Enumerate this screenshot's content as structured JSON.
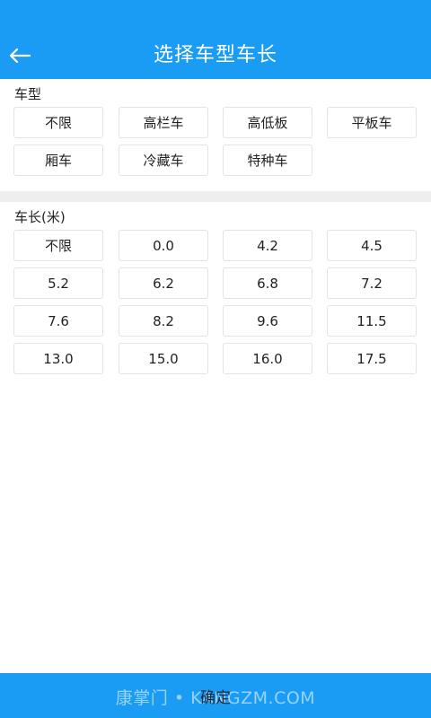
{
  "header": {
    "title": "选择车型车长",
    "background": "#1a9cf5"
  },
  "vehicle_type": {
    "label": "车型",
    "options": [
      "不限",
      "高栏车",
      "高低板",
      "平板车",
      "厢车",
      "冷藏车",
      "特种车"
    ]
  },
  "vehicle_length": {
    "label": "车长(米)",
    "options": [
      "不限",
      "0.0",
      "4.2",
      "4.5",
      "5.2",
      "6.2",
      "6.8",
      "7.2",
      "7.6",
      "8.2",
      "9.6",
      "11.5",
      "13.0",
      "15.0",
      "16.0",
      "17.5"
    ]
  },
  "footer": {
    "confirm_label": "确定",
    "watermark": "康掌门 • KANGZM.COM"
  },
  "icons": {
    "back": "arrow-left-icon"
  }
}
